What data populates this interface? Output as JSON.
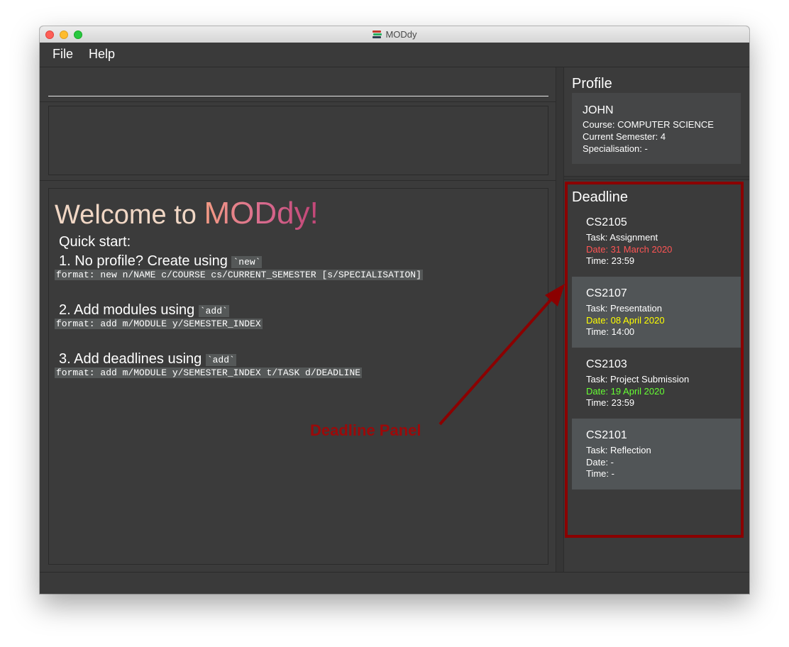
{
  "window": {
    "title": "MODdy"
  },
  "menu": {
    "items": [
      "File",
      "Help"
    ]
  },
  "command": {
    "value": ""
  },
  "welcome": {
    "prefix": "Welcome to ",
    "app_name": "MODdy",
    "exclaim": "!",
    "quick_start": "Quick start:",
    "steps": [
      {
        "text": "1. No profile? Create using ",
        "keyword": "`new`",
        "format": "format: new n/NAME c/COURSE cs/CURRENT_SEMESTER [s/SPECIALISATION]"
      },
      {
        "text": "2. Add modules using ",
        "keyword": "`add`",
        "format": "format: add m/MODULE y/SEMESTER_INDEX"
      },
      {
        "text": "3. Add deadlines using ",
        "keyword": "`add`",
        "format": "format: add m/MODULE y/SEMESTER_INDEX t/TASK d/DEADLINE"
      }
    ]
  },
  "profile": {
    "title": "Profile",
    "name": "JOHN",
    "course": "Course: COMPUTER SCIENCE",
    "semester": "Current Semester: 4",
    "specialisation": "Specialisation: -"
  },
  "deadline": {
    "title": "Deadline",
    "items": [
      {
        "code": "CS2105",
        "task": "Task: Assignment",
        "date": "Date: 31 March 2020",
        "time": "Time: 23:59",
        "date_color": "#ff5555"
      },
      {
        "code": "CS2107",
        "task": "Task: Presentation",
        "date": "Date: 08 April 2020",
        "time": "Time: 14:00",
        "date_color": "#ffff00"
      },
      {
        "code": "CS2103",
        "task": "Task: Project Submission",
        "date": "Date: 19 April 2020",
        "time": "Time: 23:59",
        "date_color": "#66ff33"
      },
      {
        "code": "CS2101",
        "task": "Task: Reflection",
        "date": "Date: -",
        "time": "Time: -",
        "date_color": "#ffffff"
      }
    ]
  },
  "annotation": {
    "label": "Deadline Panel",
    "color": "#8b0000"
  }
}
